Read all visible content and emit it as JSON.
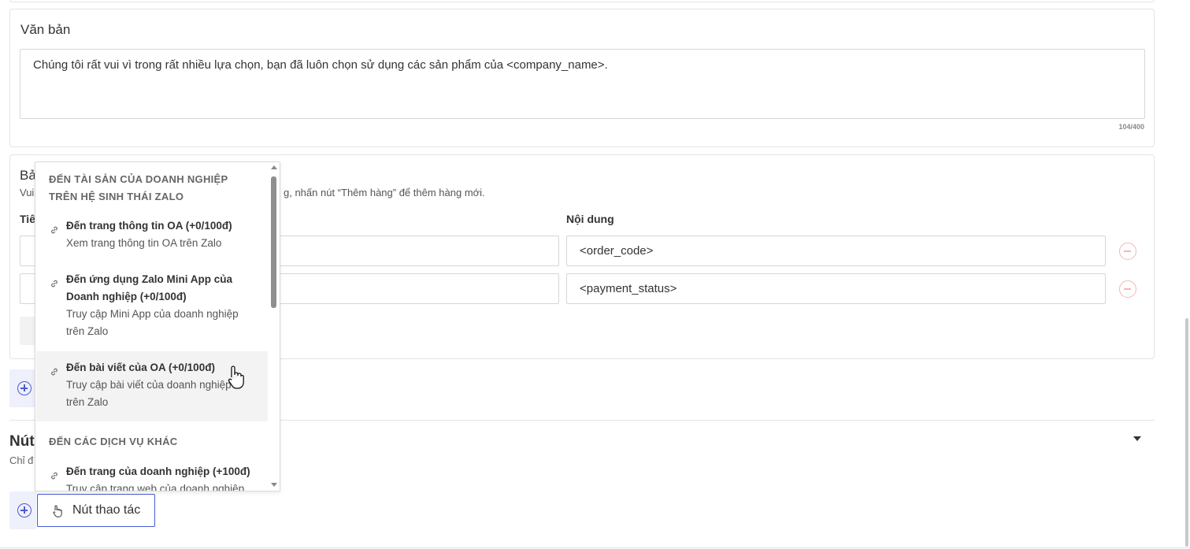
{
  "text_section": {
    "title": "Văn bản",
    "content": "Chúng tôi rất vui vì trong rất nhiều lựa chọn, bạn đã luôn chọn sử dụng các sản phẩm của <company_name>.",
    "counter": "104/400"
  },
  "table_section": {
    "title_partial": "Bả",
    "hint_left": "Vui",
    "hint_right": "g, nhấn nút “Thêm hàng” để thêm hàng mới.",
    "col_title_partial": "Tiê",
    "col_content": "Nội dung",
    "rows": [
      {
        "title_partial": "",
        "content": "<order_code>"
      },
      {
        "title_partial": "",
        "content": "<payment_status>"
      }
    ]
  },
  "buttons_section": {
    "title_partial": "Nút",
    "subtitle_partial": "Chỉ đ",
    "action_button_label": "Nút thao tác"
  },
  "dropdown": {
    "group1": [
      "ĐẾN TÀI SẢN CỦA DOANH NGHIỆP",
      "TRÊN HỆ SINH THÁI ZALO"
    ],
    "items": [
      {
        "title": "Đến trang thông tin OA (+0/100đ)",
        "desc": [
          "Xem trang thông tin OA trên Zalo"
        ]
      },
      {
        "title_lines": [
          "Đến ứng dụng Zalo Mini App của",
          "Doanh nghiệp (+0/100đ)"
        ],
        "desc": [
          "Truy cập Mini App của doanh nghiệp",
          "trên Zalo"
        ]
      },
      {
        "title": "Đến bài viết của OA (+0/100đ)",
        "desc": [
          "Truy cập bài viết của doanh nghiệp",
          "trên Zalo"
        ]
      }
    ],
    "group2": "ĐẾN CÁC DỊCH VỤ KHÁC",
    "item4": {
      "title": "Đến trang của doanh nghiệp (+100đ)",
      "desc": "Truy cập trang web của doanh nghiệp"
    }
  },
  "colors": {
    "accent": "#4a5bd4",
    "remove": "#f2b6b6",
    "border": "#d6d6d6"
  },
  "icons": [
    "link-icon",
    "plus-circle-icon",
    "minus-circle-icon",
    "hand-pointer-icon",
    "caret-down-icon"
  ]
}
